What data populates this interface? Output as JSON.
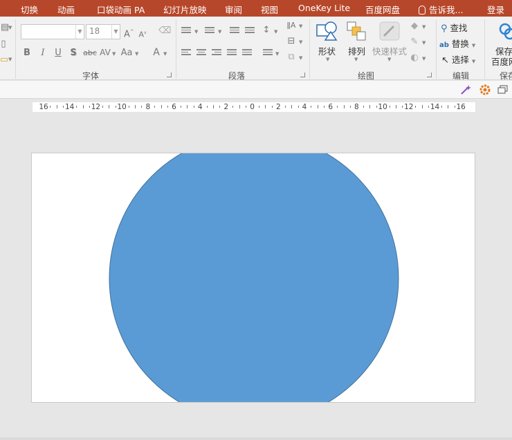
{
  "menu": {
    "tabs": [
      "切换",
      "动画",
      "口袋动画 PA",
      "幻灯片放映",
      "审阅",
      "视图",
      "OneKey Lite",
      "百度网盘"
    ],
    "tell_me": "告诉我...",
    "login": "登录"
  },
  "ribbon": {
    "font_group": {
      "label": "字体",
      "font_name": "",
      "font_size": "18",
      "buttons": [
        "B",
        "I",
        "U",
        "S",
        "abc",
        "AV",
        "Aa",
        "A"
      ]
    },
    "paragraph_group": {
      "label": "段落"
    },
    "drawing_group": {
      "label": "绘图",
      "shapes": "形状",
      "arrange": "排列",
      "quick_styles": "快速样式"
    },
    "editing_group": {
      "label": "编辑",
      "find": "查找",
      "replace": "替换",
      "select": "选择"
    },
    "save_group": {
      "save_line1": "保存",
      "save_line2": "百度网",
      "label": "保存"
    }
  },
  "ruler": {
    "labels": [
      "16",
      "14",
      "12",
      "10",
      "8",
      "6",
      "4",
      "2",
      "0",
      "2",
      "4",
      "6",
      "8",
      "10",
      "12",
      "14",
      "16"
    ]
  },
  "slide": {
    "shape": "circle",
    "fill": "#5b9bd5",
    "stroke": "#41719c"
  },
  "colors": {
    "menubar": "#b7472a",
    "ribbon": "#f1f1f1",
    "workspace": "#e6e6e6"
  }
}
